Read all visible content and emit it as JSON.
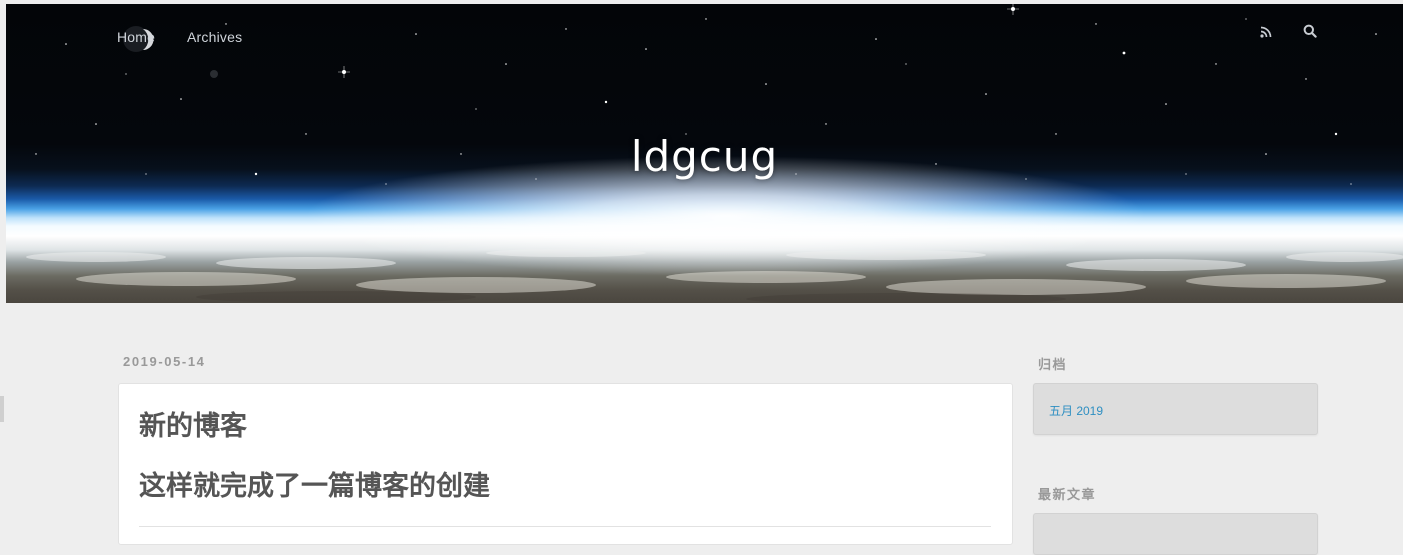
{
  "header": {
    "nav": [
      {
        "label": "Home"
      },
      {
        "label": "Archives"
      }
    ],
    "site_title": "ldgcug",
    "icons": [
      "rss-icon",
      "search-icon"
    ]
  },
  "post": {
    "date": "2019-05-14",
    "title": "新的博客",
    "heading": "这样就完成了一篇博客的创建"
  },
  "sidebar": {
    "archives": {
      "title": "归档",
      "items": [
        {
          "label": "五月 2019"
        }
      ]
    },
    "recent_posts": {
      "title": "最新文章"
    }
  },
  "colors": {
    "page_bg": "#eeeeee",
    "card_bg": "#ffffff",
    "widget_bg": "#dddddd",
    "link": "#2e8fc2",
    "muted_text": "#999999",
    "heading_text": "#555555"
  }
}
